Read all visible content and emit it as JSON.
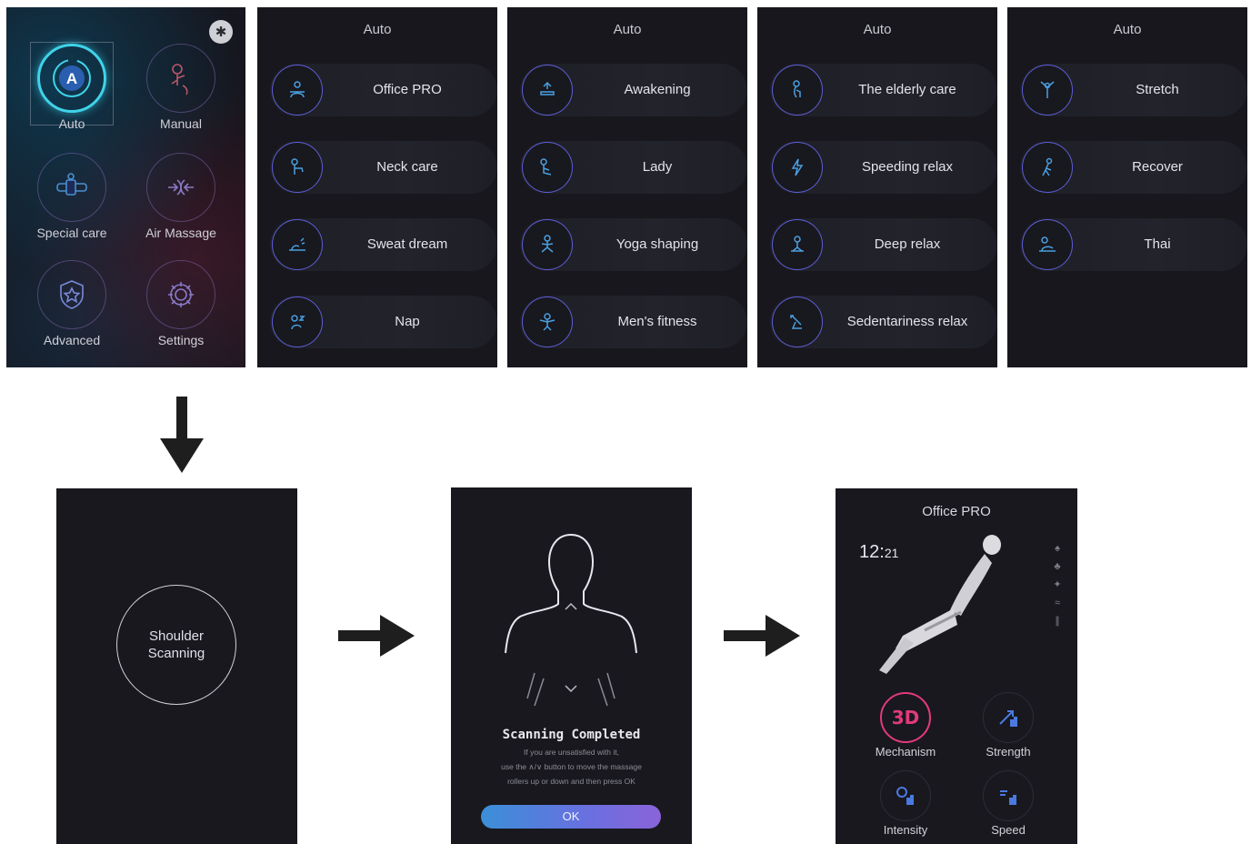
{
  "home": {
    "tiles": [
      {
        "label": "Auto",
        "icon": "auto-icon"
      },
      {
        "label": "Manual",
        "icon": "manual-hand-icon"
      },
      {
        "label": "Special care",
        "icon": "special-care-icon"
      },
      {
        "label": "Air Massage",
        "icon": "air-massage-icon"
      },
      {
        "label": "Advanced",
        "icon": "shield-star-icon"
      },
      {
        "label": "Settings",
        "icon": "gear-icon"
      }
    ],
    "auto_letter": "A",
    "bluetooth_icon": "bluetooth-icon"
  },
  "auto_pages": [
    {
      "title": "Auto",
      "items": [
        "Office PRO",
        "Neck care",
        "Sweat dream",
        "Nap"
      ]
    },
    {
      "title": "Auto",
      "items": [
        "Awakening",
        "Lady",
        "Yoga shaping",
        "Men's fitness"
      ]
    },
    {
      "title": "Auto",
      "items": [
        "The elderly care",
        "Speeding relax",
        "Deep relax",
        "Sedentariness relax"
      ]
    },
    {
      "title": "Auto",
      "items": [
        "Stretch",
        "Recover",
        "Thai"
      ]
    }
  ],
  "scan": {
    "line1": "Shoulder",
    "line2": "Scanning"
  },
  "done": {
    "title": "Scanning Completed",
    "line1": "If you are unsatisfied with it,",
    "line2": "use the ∧/∨ button to move the massage",
    "line3": "rollers up or down and then press OK",
    "ok": "OK"
  },
  "run": {
    "title": "Office PRO",
    "time_h": "12",
    "time_m": "21",
    "controls": [
      {
        "label": "Mechanism",
        "value": "3D"
      },
      {
        "label": "Strength"
      },
      {
        "label": "Intensity"
      },
      {
        "label": "Speed"
      }
    ]
  },
  "colors": {
    "accent": "#3fd3ea",
    "icon_ring": "#5d5fd8",
    "hot": "#e23a7a",
    "panel": "#17171d"
  }
}
